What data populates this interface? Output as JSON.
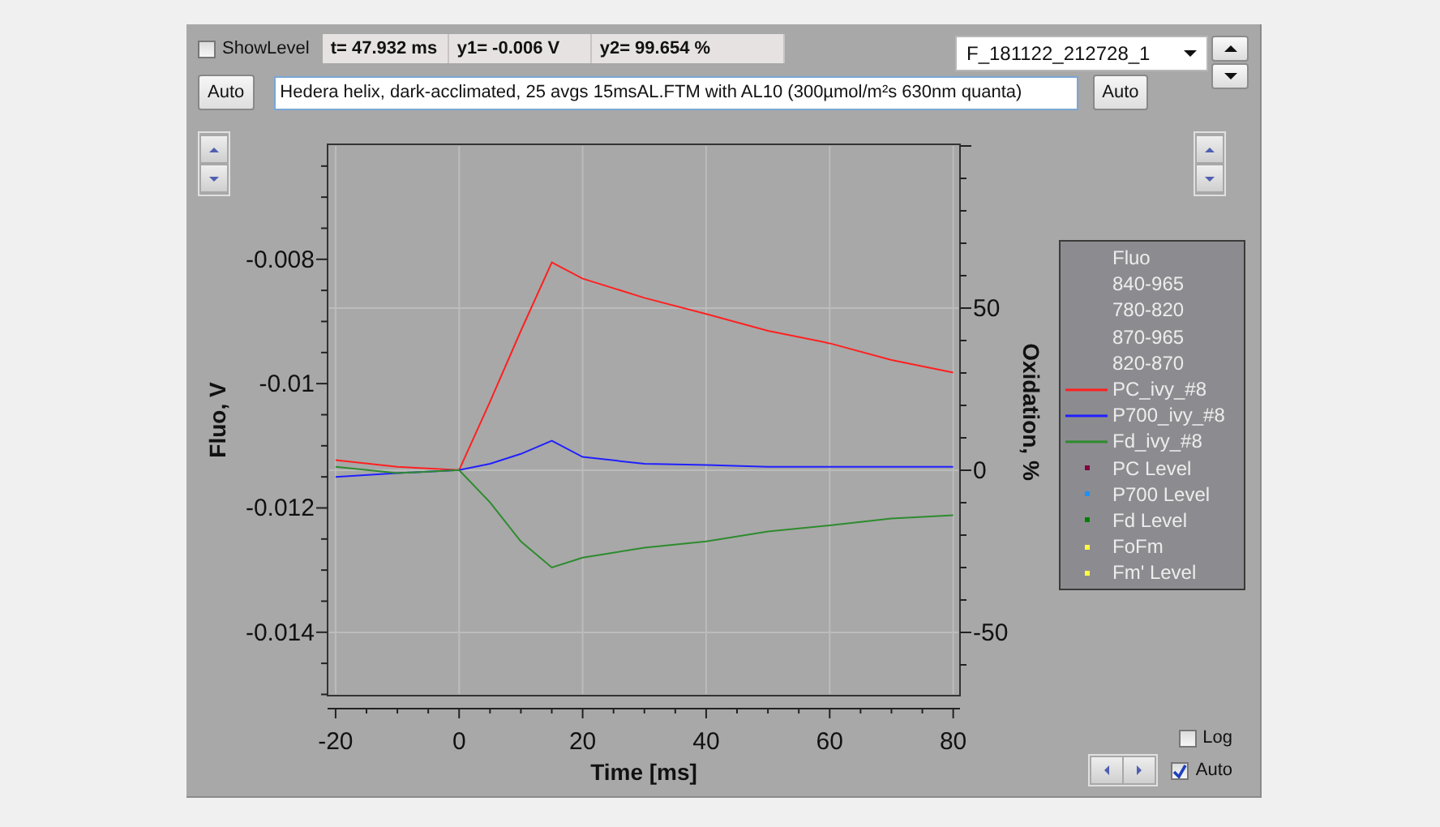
{
  "toolbar": {
    "show_level": {
      "label": "ShowLevel",
      "checked": false
    },
    "readouts": [
      "t= 47.932 ms",
      "y1= -0.006 V",
      "y2= 99.654 %"
    ],
    "file_select": {
      "value": "F_181122_212728_1"
    },
    "auto_left": "Auto",
    "comment": {
      "value": "Hedera helix, dark-acclimated, 25 avgs 15msAL.FTM with AL10 (300µmol/m²s 630nm quanta)"
    },
    "auto_right": "Auto"
  },
  "chart": {
    "chart_data": {
      "type": "line",
      "xlabel": "Time [ms]",
      "ylabel": "Fluo, V",
      "y2label": "Oxidation, %",
      "grid": true,
      "x": [
        -20,
        -10,
        0,
        5,
        10,
        15,
        20,
        30,
        40,
        50,
        60,
        70,
        80
      ],
      "xlim": [
        -21.3,
        81.1
      ],
      "ylim": [
        -0.01502,
        -0.00615
      ],
      "y2lim": [
        -69.5,
        100.5
      ],
      "xticks": [
        -20,
        0,
        20,
        40,
        60,
        80
      ],
      "yticks": [
        -0.008,
        -0.01,
        -0.012,
        -0.014
      ],
      "y2ticks": [
        50,
        0,
        -50
      ],
      "series": [
        {
          "name": "PC_ivy_#8",
          "color": "#ff2020",
          "values": [
            -0.01123,
            -0.01134,
            -0.01139,
            -0.01029,
            -0.00915,
            -0.00805,
            -0.00831,
            -0.00862,
            -0.00888,
            -0.00915,
            -0.00935,
            -0.00962,
            -0.00982
          ]
        },
        {
          "name": "P700_ivy_#8",
          "color": "#2020ff",
          "values": [
            -0.0115,
            -0.01144,
            -0.01139,
            -0.01129,
            -0.01113,
            -0.01092,
            -0.01118,
            -0.01129,
            -0.01131,
            -0.01134,
            -0.01134,
            -0.01134,
            -0.01134
          ]
        },
        {
          "name": "Fd_ivy_#8",
          "color": "#2e8b2e",
          "values": [
            -0.01134,
            -0.01144,
            -0.01139,
            -0.01191,
            -0.01254,
            -0.01296,
            -0.0128,
            -0.01264,
            -0.01254,
            -0.01238,
            -0.01228,
            -0.01217,
            -0.01212
          ]
        }
      ]
    },
    "legend": {
      "headers": [
        "Fluo",
        "840-965",
        "780-820",
        "870-965",
        "820-870"
      ],
      "markers": [
        {
          "label": "PC Level",
          "color": "#800040"
        },
        {
          "label": "P700 Level",
          "color": "#1e90ff"
        },
        {
          "label": "Fd Level",
          "color": "#008000"
        },
        {
          "label": "FoFm",
          "color": "#ffff40"
        },
        {
          "label": "Fm' Level",
          "color": "#ffff40"
        }
      ]
    }
  },
  "log": {
    "label": "Log",
    "checked": false
  },
  "auto": {
    "label": "Auto",
    "checked": true
  }
}
